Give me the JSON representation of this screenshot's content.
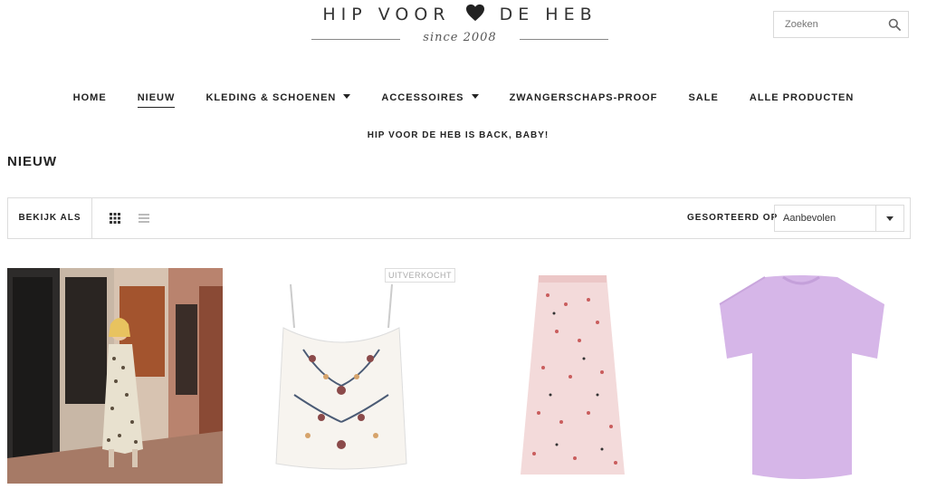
{
  "header": {
    "logo_text_left": "HIP VOOR",
    "logo_text_right": "DE HEB",
    "logo_sub": "since 2008",
    "search_placeholder": "Zoeken"
  },
  "nav": {
    "items": [
      {
        "label": "HOME",
        "has_dropdown": false,
        "active": false
      },
      {
        "label": "NIEUW",
        "has_dropdown": false,
        "active": true
      },
      {
        "label": "KLEDING & SCHOENEN",
        "has_dropdown": true,
        "active": false
      },
      {
        "label": "ACCESSOIRES",
        "has_dropdown": true,
        "active": false
      },
      {
        "label": "ZWANGERSCHAPS-PROOF",
        "has_dropdown": false,
        "active": false
      },
      {
        "label": "SALE",
        "has_dropdown": false,
        "active": false
      },
      {
        "label": "ALLE PRODUCTEN",
        "has_dropdown": false,
        "active": false
      }
    ]
  },
  "promo": "HIP VOOR DE HEB IS BACK, BABY!",
  "page_title": "NIEUW",
  "toolbar": {
    "view_label": "BEKIJK ALS",
    "view_icons": [
      "grid-view-icon",
      "list-view-icon"
    ],
    "sort_label": "GESORTEERD OP",
    "sort_value": "Aanbevolen"
  },
  "products": [
    {
      "image": "model-in-floral-dress-photo"
    },
    {
      "image": "embroidered-white-cami-top",
      "badge": "UITVERKOCHT"
    },
    {
      "image": "pink-floral-midi-skirt"
    },
    {
      "image": "lilac-tshirt"
    }
  ],
  "colors": {
    "text": "#222222",
    "border": "#dcdcdc",
    "lilac": "#d3b3e6",
    "skirt_pink": "#f2d6d6"
  }
}
